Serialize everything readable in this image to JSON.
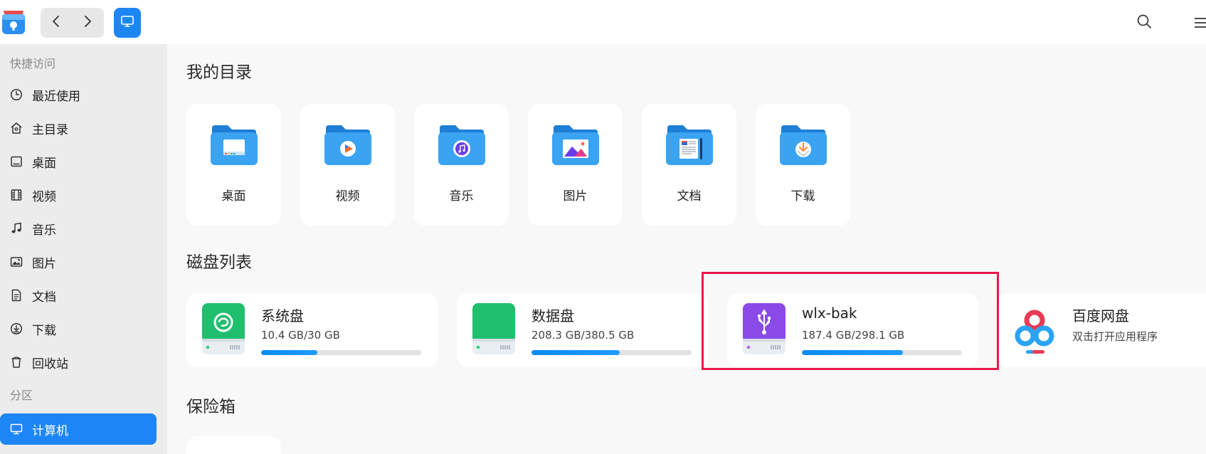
{
  "colors": {
    "accent": "#1d86f5",
    "highlight": "#e8194b",
    "progress": "#0a8af5"
  },
  "toolbar": {
    "app_icon": "file-manager-icon",
    "back_icon": "chevron-left-icon",
    "forward_icon": "chevron-right-icon",
    "view_icon": "computer-icon",
    "search_icon": "search-icon",
    "menu_icon": "menu-icon"
  },
  "sidebar": {
    "quick_access_title": "快捷访问",
    "items": [
      {
        "label": "最近使用",
        "icon": "clock-icon"
      },
      {
        "label": "主目录",
        "icon": "home-icon"
      },
      {
        "label": "桌面",
        "icon": "desktop-icon"
      },
      {
        "label": "视频",
        "icon": "film-icon"
      },
      {
        "label": "音乐",
        "icon": "music-note-icon"
      },
      {
        "label": "图片",
        "icon": "image-icon"
      },
      {
        "label": "文档",
        "icon": "document-icon"
      },
      {
        "label": "下载",
        "icon": "download-icon"
      },
      {
        "label": "回收站",
        "icon": "trash-icon"
      }
    ],
    "partition_title": "分区",
    "partition_items": [
      {
        "label": "计算机",
        "icon": "computer-icon",
        "active": true
      }
    ]
  },
  "main": {
    "my_dirs_title": "我的目录",
    "dirs": [
      {
        "label": "桌面",
        "icon": "desktop-folder-icon"
      },
      {
        "label": "视频",
        "icon": "video-folder-icon"
      },
      {
        "label": "音乐",
        "icon": "music-folder-icon"
      },
      {
        "label": "图片",
        "icon": "pictures-folder-icon"
      },
      {
        "label": "文档",
        "icon": "documents-folder-icon"
      },
      {
        "label": "下载",
        "icon": "downloads-folder-icon"
      }
    ],
    "disks_title": "磁盘列表",
    "disks": [
      {
        "name": "系统盘",
        "size": "10.4 GB/30 GB",
        "usage": 0.35,
        "icon": "system-disk-icon"
      },
      {
        "name": "数据盘",
        "size": "208.3 GB/380.5 GB",
        "usage": 0.55,
        "icon": "data-disk-icon"
      },
      {
        "name": "wlx-bak",
        "size": "187.4 GB/298.1 GB",
        "usage": 0.63,
        "icon": "usb-disk-icon"
      },
      {
        "name": "百度网盘",
        "size": "双击打开应用程序",
        "icon": "baidu-netdisk-icon"
      }
    ],
    "vault_title": "保险箱"
  }
}
